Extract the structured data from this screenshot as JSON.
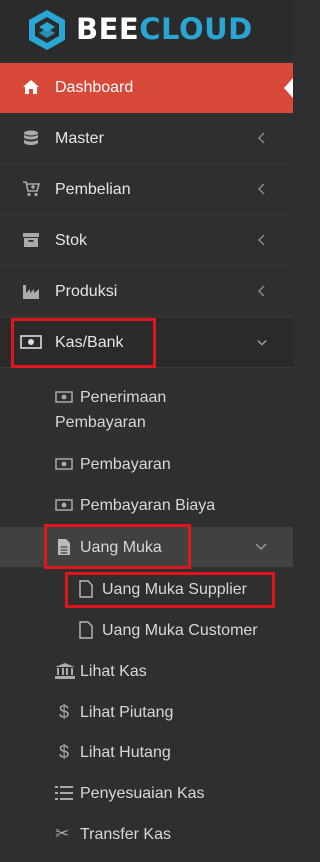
{
  "brand": {
    "part1": "BEE",
    "part2": "CLOUD",
    "accent": "#2aa6d4"
  },
  "menu": {
    "dashboard": {
      "label": "Dashboard",
      "icon": "home-icon"
    },
    "master": {
      "label": "Master",
      "icon": "database-icon"
    },
    "pembelian": {
      "label": "Pembelian",
      "icon": "cart-plus-icon"
    },
    "stok": {
      "label": "Stok",
      "icon": "archive-icon"
    },
    "produksi": {
      "label": "Produksi",
      "icon": "factory-icon"
    },
    "kasbank": {
      "label": "Kas/Bank",
      "icon": "money-icon"
    }
  },
  "kasbank_sub": {
    "penerimaan_line1": "Penerimaan",
    "penerimaan_line2": "Pembayaran",
    "pembayaran": "Pembayaran",
    "pembayaran_biaya": "Pembayaran Biaya",
    "uang_muka": "Uang Muka",
    "uang_muka_supplier": "Uang Muka Supplier",
    "uang_muka_customer": "Uang Muka Customer",
    "lihat_kas": "Lihat Kas",
    "lihat_piutang": "Lihat Piutang",
    "lihat_hutang": "Lihat Hutang",
    "penyesuaian_kas": "Penyesuaian Kas",
    "transfer_kas": "Transfer Kas"
  },
  "colors": {
    "active_bg": "#d9493a",
    "highlight": "#e0161e"
  }
}
